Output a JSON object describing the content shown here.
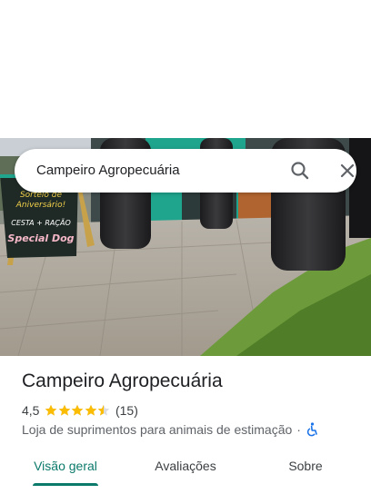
{
  "search": {
    "query": "Campeiro Agropecuária",
    "search_icon": "search-icon",
    "close_icon": "close-icon"
  },
  "hero": {
    "sign_lines": [
      "Sorteio de",
      "Aniversário!",
      "CESTA + RAÇÃO",
      "Special Dog"
    ]
  },
  "place": {
    "name": "Campeiro Agropecuária",
    "rating": "4,5",
    "stars": 4.5,
    "reviews": "(15)",
    "category": "Loja de suprimentos para animais de estimação",
    "separator": "·",
    "accessibility_icon": "wheelchair-icon"
  },
  "tabs": [
    {
      "label": "Visão geral",
      "active": true
    },
    {
      "label": "Avaliações",
      "active": false
    },
    {
      "label": "Sobre",
      "active": false
    }
  ],
  "colors": {
    "accent": "#0b7a6b",
    "star": "#fbbc04",
    "access": "#1a73e8"
  }
}
